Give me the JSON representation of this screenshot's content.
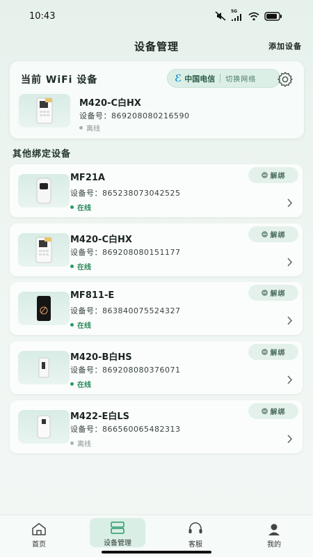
{
  "status_bar": {
    "time": "10:43",
    "network": "5G"
  },
  "nav": {
    "title": "设备管理",
    "action": "添加设备"
  },
  "current": {
    "title": "当前 WiFi 设备",
    "carrier": "中国电信",
    "switch_label": "切换网络",
    "device": {
      "name": "M420-C白HX",
      "number": "设备号：869208080216590",
      "status": "离线"
    }
  },
  "others": {
    "title": "其他绑定设备",
    "unbind_label": "解绑",
    "devices": [
      {
        "name": "MF21A",
        "number": "设备号：865238073042525",
        "status": "在线"
      },
      {
        "name": "M420-C白HX",
        "number": "设备号：869208080151177",
        "status": "在线"
      },
      {
        "name": "MF811-E",
        "number": "设备号：863840075524327",
        "status": "在线"
      },
      {
        "name": "M420-B白HS",
        "number": "设备号：869208080376071",
        "status": "在线"
      },
      {
        "name": "M422-E白LS",
        "number": "设备号：866560065482313",
        "status": "离线"
      }
    ]
  },
  "tabs": [
    {
      "label": "首页",
      "icon": "home-icon"
    },
    {
      "label": "设备管理",
      "icon": "device-list-icon"
    },
    {
      "label": "客服",
      "icon": "headset-icon"
    },
    {
      "label": "我的",
      "icon": "user-icon"
    }
  ],
  "colors": {
    "accent": "#2a9a64",
    "card_bg": "#fbfdfc",
    "page_bg": "#e6f1ec",
    "active_tab": "#d9efe6"
  }
}
